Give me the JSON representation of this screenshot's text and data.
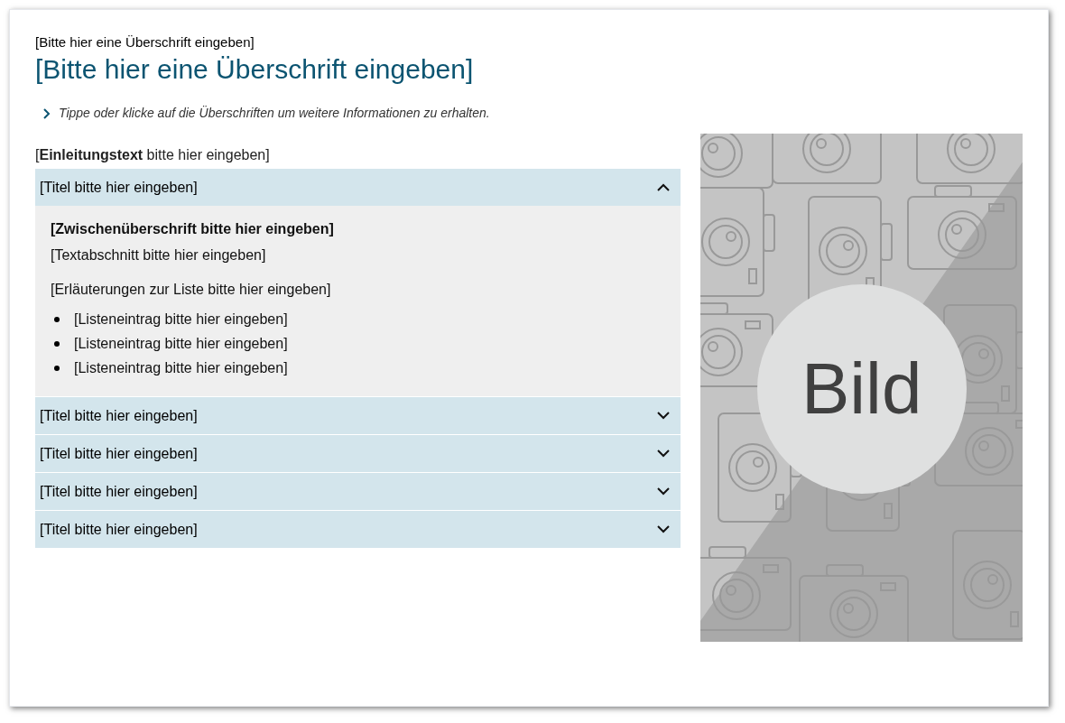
{
  "kicker": "[Bitte hier eine Überschrift eingeben]",
  "title": "[Bitte hier eine Überschrift eingeben]",
  "hint": "Tippe oder klicke auf die Überschriften um weitere Informationen zu erhalten.",
  "intro": "[**Einleitungstext** bitte hier eingeben]",
  "accordion": [
    {
      "title": "[Titel bitte hier eingeben]",
      "expanded": true,
      "content": {
        "subheading": "[Zwischenüberschrift bitte hier eingeben]",
        "paragraph": "[Textabschnitt bitte hier eingeben]",
        "list_intro": "[Erläuterungen zur Liste bitte hier eingeben]",
        "list": [
          "[Listeneintrag bitte hier eingeben]",
          "[Listeneintrag bitte hier eingeben]",
          "[Listeneintrag bitte hier eingeben]"
        ]
      }
    },
    {
      "title": "[Titel bitte hier eingeben]",
      "expanded": false
    },
    {
      "title": "[Titel bitte hier eingeben]",
      "expanded": false
    },
    {
      "title": "[Titel bitte hier eingeben]",
      "expanded": false
    },
    {
      "title": "[Titel bitte hier eingeben]",
      "expanded": false
    }
  ],
  "image": {
    "label": "Bild"
  }
}
